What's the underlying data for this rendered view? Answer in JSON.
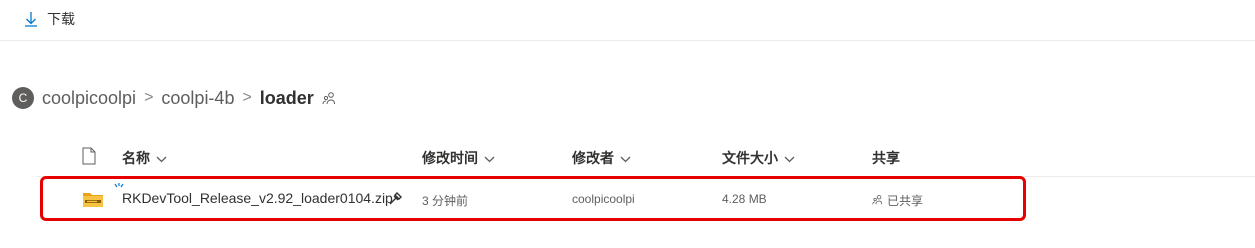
{
  "toolbar": {
    "download_label": "下载"
  },
  "breadcrumb": {
    "avatar_letter": "C",
    "items": [
      "coolpicoolpi",
      "coolpi-4b",
      "loader"
    ],
    "separator": ">"
  },
  "table": {
    "columns": {
      "name": "名称",
      "modified": "修改时间",
      "modified_by": "修改者",
      "size": "文件大小",
      "sharing": "共享"
    },
    "rows": [
      {
        "name": "RKDevTool_Release_v2.92_loader0104.zip",
        "modified": "3 分钟前",
        "modified_by": "coolpicoolpi",
        "size": "4.28 MB",
        "sharing": "已共享"
      }
    ]
  },
  "colors": {
    "accent": "#0078d4",
    "highlight_border": "#e60000",
    "folder": "#e8a317"
  }
}
